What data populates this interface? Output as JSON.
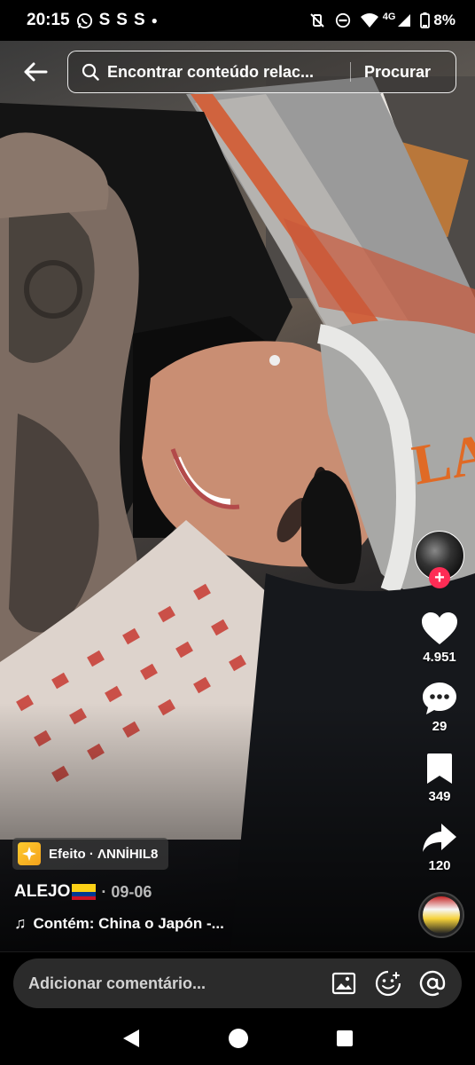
{
  "status_bar": {
    "time": "20:15",
    "notification_letters": [
      "S",
      "S",
      "S"
    ],
    "network": "4G",
    "battery": "8%"
  },
  "search": {
    "query": "Encontrar conteúdo relac...",
    "button_label": "Procurar"
  },
  "rail": {
    "likes": "4.951",
    "comments": "29",
    "saves": "349",
    "shares": "120"
  },
  "effect": {
    "label": "Efeito · ΛNNİHIL8"
  },
  "post": {
    "author": "ALEJO",
    "date": "· 09-06",
    "music": "Contém: China o Japón -..."
  },
  "comment_bar": {
    "placeholder": "Adicionar comentário..."
  },
  "colors": {
    "follow_plus": "#fe2c55",
    "comment_field": "#2b2b2b",
    "effect_chip": "#f3a21c"
  },
  "icons": {
    "back": "arrow-left-icon",
    "search": "magnifier-icon",
    "like": "heart-icon",
    "comment": "speech-bubble-icon",
    "save": "bookmark-icon",
    "share": "share-arrow-icon",
    "image": "image-icon",
    "emoji": "emoji-icon",
    "mention": "at-sign-icon"
  }
}
